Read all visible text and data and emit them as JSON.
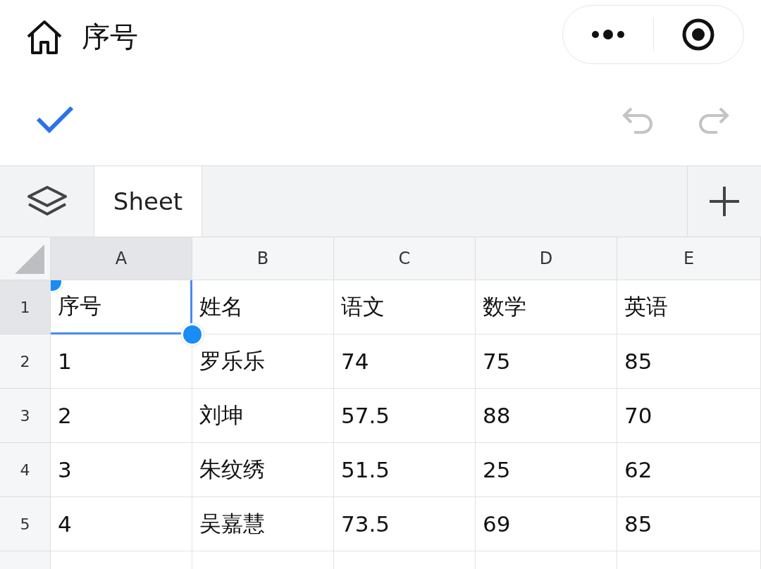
{
  "header": {
    "title": "序号"
  },
  "sheet_tabs": [
    {
      "label": "Sheet",
      "selected": true
    }
  ],
  "columns": [
    {
      "label": "A",
      "selected": true
    },
    {
      "label": "B",
      "selected": false
    },
    {
      "label": "C",
      "selected": false
    },
    {
      "label": "D",
      "selected": false
    },
    {
      "label": "E",
      "selected": false
    }
  ],
  "rows": [
    {
      "number": "1",
      "selected": true,
      "cells": [
        {
          "text": "序号",
          "selected": true
        },
        {
          "text": "姓名",
          "selected": false
        },
        {
          "text": "语文",
          "selected": false
        },
        {
          "text": "数学",
          "selected": false
        },
        {
          "text": "英语",
          "selected": false
        }
      ]
    },
    {
      "number": "2",
      "selected": false,
      "cells": [
        {
          "text": "1",
          "selected": false
        },
        {
          "text": "罗乐乐",
          "selected": false
        },
        {
          "text": "74",
          "selected": false
        },
        {
          "text": "75",
          "selected": false
        },
        {
          "text": "85",
          "selected": false
        }
      ]
    },
    {
      "number": "3",
      "selected": false,
      "cells": [
        {
          "text": "2",
          "selected": false
        },
        {
          "text": "刘坤",
          "selected": false
        },
        {
          "text": "57.5",
          "selected": false
        },
        {
          "text": "88",
          "selected": false
        },
        {
          "text": "70",
          "selected": false
        }
      ]
    },
    {
      "number": "4",
      "selected": false,
      "cells": [
        {
          "text": "3",
          "selected": false
        },
        {
          "text": "朱纹绣",
          "selected": false
        },
        {
          "text": "51.5",
          "selected": false
        },
        {
          "text": "25",
          "selected": false
        },
        {
          "text": "62",
          "selected": false
        }
      ]
    },
    {
      "number": "5",
      "selected": false,
      "cells": [
        {
          "text": "4",
          "selected": false
        },
        {
          "text": "吴嘉慧",
          "selected": false
        },
        {
          "text": "73.5",
          "selected": false
        },
        {
          "text": "69",
          "selected": false
        },
        {
          "text": "85",
          "selected": false
        }
      ]
    }
  ]
}
